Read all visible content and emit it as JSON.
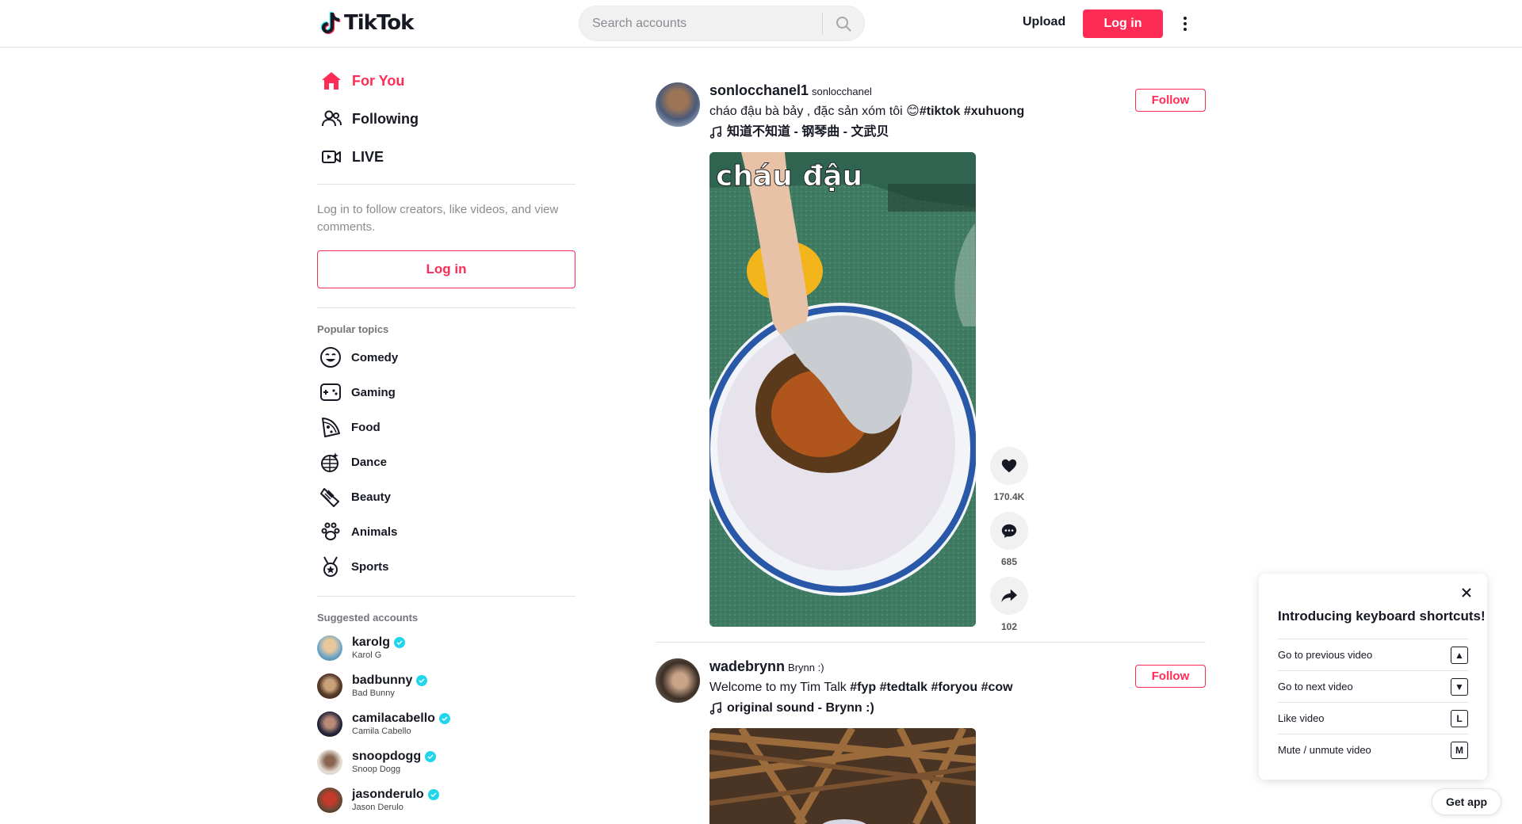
{
  "header": {
    "logo_text": "TikTok",
    "search_placeholder": "Search accounts",
    "upload_label": "Upload",
    "login_label": "Log in"
  },
  "sidebar": {
    "nav": [
      {
        "label": "For You",
        "icon": "home-icon",
        "active": true
      },
      {
        "label": "Following",
        "icon": "people-icon",
        "active": false
      },
      {
        "label": "LIVE",
        "icon": "live-icon",
        "active": false
      }
    ],
    "login_hint": "Log in to follow creators, like videos, and view comments.",
    "login_label": "Log in",
    "topics_title": "Popular topics",
    "topics": [
      {
        "label": "Comedy",
        "icon": "smile-icon"
      },
      {
        "label": "Gaming",
        "icon": "gamepad-icon"
      },
      {
        "label": "Food",
        "icon": "pizza-icon"
      },
      {
        "label": "Dance",
        "icon": "disco-ball-icon"
      },
      {
        "label": "Beauty",
        "icon": "comb-icon"
      },
      {
        "label": "Animals",
        "icon": "paw-icon"
      },
      {
        "label": "Sports",
        "icon": "medal-icon"
      }
    ],
    "accounts_title": "Suggested accounts",
    "accounts": [
      {
        "username": "karolg",
        "name": "Karol G"
      },
      {
        "username": "badbunny",
        "name": "Bad Bunny"
      },
      {
        "username": "camilacabello",
        "name": "Camila Cabello"
      },
      {
        "username": "snoopdogg",
        "name": "Snoop Dogg"
      },
      {
        "username": "jasonderulo",
        "name": "Jason Derulo"
      }
    ]
  },
  "posts": [
    {
      "author": "sonlocchanel1",
      "nickname": "sonlocchanel",
      "caption_text": "cháo đậu bà bảy , đặc sản xóm tôi 😊",
      "caption_tags": "#tiktok #xuhuong",
      "music": "知道不知道 - 钢琴曲 - 文武贝",
      "follow_label": "Follow",
      "video_overlay_text": "cháu đậu",
      "likes": "170.4K",
      "comments": "685",
      "shares": "102"
    },
    {
      "author": "wadebrynn",
      "nickname": "Brynn :)",
      "caption_text": "Welcome to my Tim Talk ",
      "caption_tags": "#fyp #tedtalk #foryou #cow",
      "music": "original sound - Brynn :)",
      "follow_label": "Follow"
    }
  ],
  "keyboard_shortcuts": {
    "title": "Introducing keyboard shortcuts!",
    "rows": [
      {
        "label": "Go to previous video",
        "key": "▲"
      },
      {
        "label": "Go to next video",
        "key": "▼"
      },
      {
        "label": "Like video",
        "key": "L"
      },
      {
        "label": "Mute / unmute video",
        "key": "M"
      }
    ]
  },
  "get_app_label": "Get app",
  "colors": {
    "brand": "#fe2c55",
    "text": "#161823",
    "verified": "#20d5ec"
  }
}
